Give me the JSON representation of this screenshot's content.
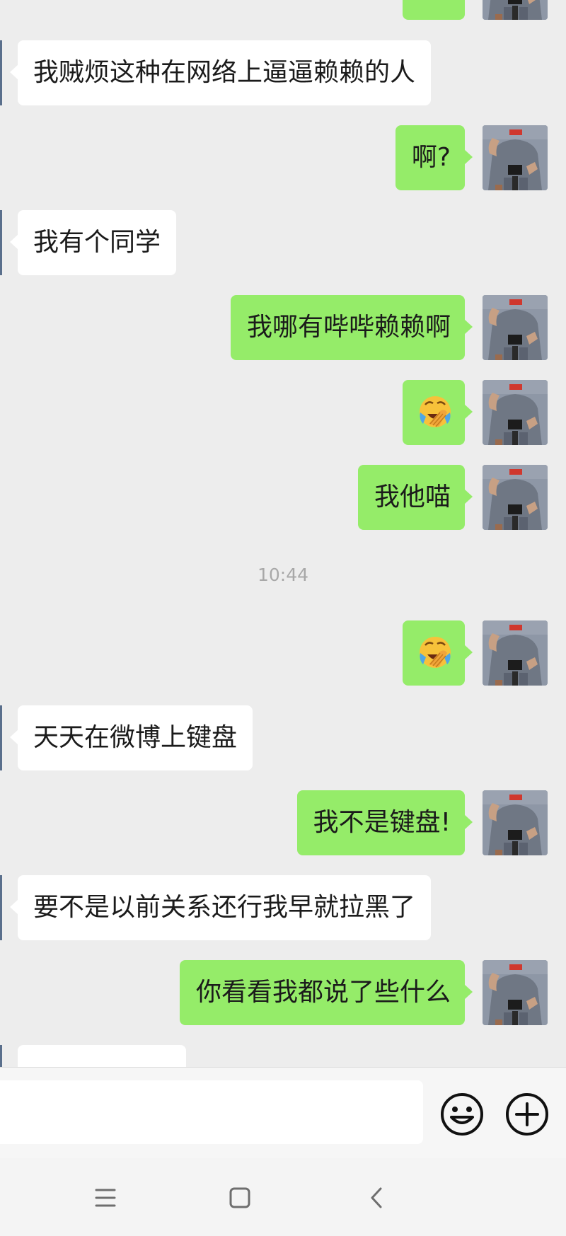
{
  "messages": [
    {
      "dir": "out",
      "type": "partial"
    },
    {
      "dir": "in",
      "type": "text",
      "text": "我贼烦这种在网络上逼逼赖赖的人"
    },
    {
      "dir": "out",
      "type": "text",
      "text": "啊?"
    },
    {
      "dir": "in",
      "type": "text",
      "text": "我有个同学"
    },
    {
      "dir": "out",
      "type": "text",
      "text": "我哪有哔哔赖赖啊"
    },
    {
      "dir": "out",
      "type": "emoji",
      "emoji": "face-palm-crying-laughing-emoji"
    },
    {
      "dir": "out",
      "type": "text",
      "text": "我他喵"
    },
    {
      "type": "time",
      "text": "10:44"
    },
    {
      "dir": "out",
      "type": "emoji",
      "emoji": "face-palm-crying-laughing-emoji"
    },
    {
      "dir": "in",
      "type": "text",
      "text": "天天在微博上键盘"
    },
    {
      "dir": "out",
      "type": "text",
      "text": "我不是键盘!"
    },
    {
      "dir": "in",
      "type": "text",
      "text": "要不是以前关系还行我早就拉黑了"
    },
    {
      "dir": "out",
      "type": "text",
      "text": "你看看我都说了些什么"
    },
    {
      "dir": "in",
      "type": "partial"
    }
  ],
  "input": {
    "value": "",
    "placeholder": ""
  },
  "icons": {
    "emoji_button": "smiley-face-icon",
    "plus_button": "plus-circle-icon",
    "nav_menu": "menu-lines-icon",
    "nav_home": "square-home-icon",
    "nav_back": "chevron-left-icon"
  },
  "colors": {
    "background": "#ededed",
    "outgoing_bubble": "#95ec69",
    "incoming_bubble": "#ffffff",
    "timestamp": "#a8a8a8"
  }
}
